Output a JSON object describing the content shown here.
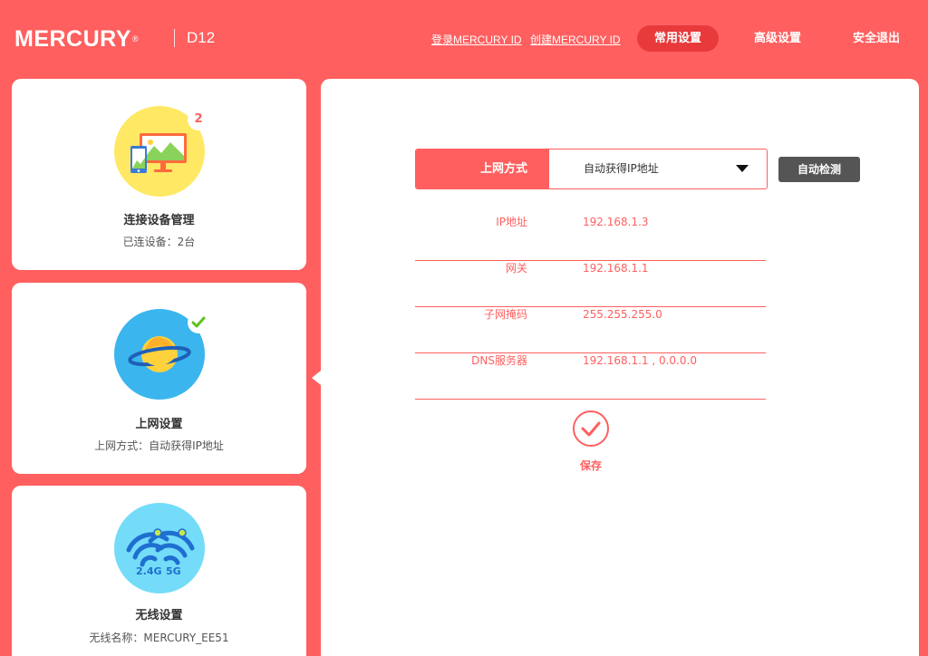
{
  "header": {
    "logo": "MERCURY",
    "logo_mark": "®",
    "model": "D12",
    "login_link": "登录MERCURY ID",
    "create_link": "创建MERCURY ID",
    "nav": [
      "常用设置",
      "高级设置",
      "安全退出"
    ],
    "active_nav": "常用设置"
  },
  "cards": [
    {
      "title": "连接设备管理",
      "subtitle": "已连设备：2台",
      "badge": "2",
      "icon": "devices-icon",
      "icon_color": "#ffe864"
    },
    {
      "title": "上网设置",
      "subtitle": "上网方式：自动获得IP地址",
      "badge_icon": "check-icon",
      "icon": "planet-icon",
      "icon_color": "#3ab5ee",
      "selected": true
    },
    {
      "title": "无线设置",
      "subtitle": "无线名称：MERCURY_EE51",
      "icon": "wifi-icon",
      "icon_color": "#74dcf8",
      "wifi_bands": [
        "2.4G",
        "5G"
      ]
    }
  ],
  "panel": {
    "connection_type_label": "上网方式",
    "connection_type_value": "自动获得IP地址",
    "detect_button": "自动检测",
    "rows": [
      {
        "label": "IP地址",
        "value": "192.168.1.3"
      },
      {
        "label": "网关",
        "value": "192.168.1.1"
      },
      {
        "label": "子网掩码",
        "value": "255.255.255.0"
      },
      {
        "label": "DNS服务器",
        "value": "192.168.1.1 , 0.0.0.0"
      }
    ],
    "save_label": "保存"
  },
  "colors": {
    "brand": "#ff5f5f",
    "nav_active": "#e8393b",
    "button_dark": "#555555",
    "check_green": "#5cc21f"
  }
}
